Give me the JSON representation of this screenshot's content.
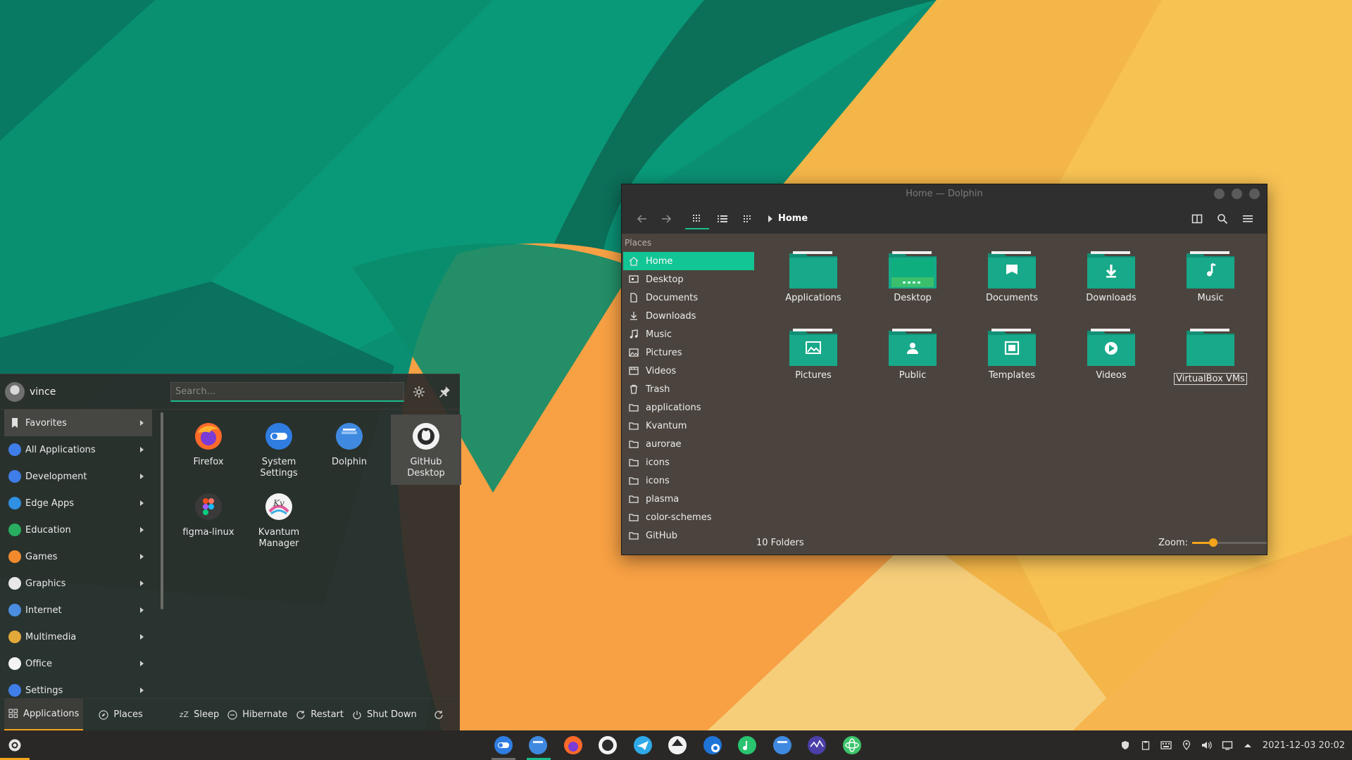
{
  "colors": {
    "accent": "#1abc8c",
    "highlight": "#f2a41a",
    "folder": "#17a98a"
  },
  "dolphin": {
    "title": "Home — Dolphin",
    "breadcrumb": "Home",
    "places_header": "Places",
    "places": [
      {
        "label": "Home",
        "icon": "home-icon"
      },
      {
        "label": "Desktop",
        "icon": "desktop-icon"
      },
      {
        "label": "Documents",
        "icon": "document-icon"
      },
      {
        "label": "Downloads",
        "icon": "download-icon"
      },
      {
        "label": "Music",
        "icon": "music-icon"
      },
      {
        "label": "Pictures",
        "icon": "picture-icon"
      },
      {
        "label": "Videos",
        "icon": "video-icon"
      },
      {
        "label": "Trash",
        "icon": "trash-icon"
      },
      {
        "label": "applications",
        "icon": "folder-icon"
      },
      {
        "label": "Kvantum",
        "icon": "folder-icon"
      },
      {
        "label": "aurorae",
        "icon": "folder-icon"
      },
      {
        "label": "icons",
        "icon": "folder-icon"
      },
      {
        "label": "icons",
        "icon": "folder-icon"
      },
      {
        "label": "plasma",
        "icon": "folder-icon"
      },
      {
        "label": "color-schemes",
        "icon": "folder-icon"
      },
      {
        "label": "GitHub",
        "icon": "folder-icon"
      }
    ],
    "folders": [
      {
        "label": "Applications",
        "emblem": "none"
      },
      {
        "label": "Desktop",
        "emblem": "desktop"
      },
      {
        "label": "Documents",
        "emblem": "document"
      },
      {
        "label": "Downloads",
        "emblem": "download"
      },
      {
        "label": "Music",
        "emblem": "music"
      },
      {
        "label": "Pictures",
        "emblem": "picture"
      },
      {
        "label": "Public",
        "emblem": "person"
      },
      {
        "label": "Templates",
        "emblem": "template"
      },
      {
        "label": "Videos",
        "emblem": "play"
      },
      {
        "label": "VirtualBox VMs",
        "emblem": "none"
      }
    ],
    "status": "10 Folders",
    "zoom_label": "Zoom:",
    "zoom_level": 0.28
  },
  "launcher": {
    "user": "vince",
    "search_placeholder": "Search...",
    "categories": [
      {
        "label": "Favorites",
        "color": "#d8d8d8"
      },
      {
        "label": "All Applications",
        "color": "#3f7ee8"
      },
      {
        "label": "Development",
        "color": "#3f7ee8"
      },
      {
        "label": "Edge Apps",
        "color": "#2f8fe0"
      },
      {
        "label": "Education",
        "color": "#27ae60"
      },
      {
        "label": "Games",
        "color": "#f08a2c"
      },
      {
        "label": "Graphics",
        "color": "#e8e8e8"
      },
      {
        "label": "Internet",
        "color": "#4b8de0"
      },
      {
        "label": "Multimedia",
        "color": "#e3a83a"
      },
      {
        "label": "Office",
        "color": "#f4f4f4"
      },
      {
        "label": "Settings",
        "color": "#3f7ee8"
      }
    ],
    "apps": [
      {
        "label": "Firefox",
        "icon": "firefox-icon"
      },
      {
        "label": "System Settings",
        "icon": "system-settings-icon"
      },
      {
        "label": "Dolphin",
        "icon": "dolphin-icon"
      },
      {
        "label": "GitHub Desktop",
        "icon": "github-icon"
      },
      {
        "label": "figma-linux",
        "icon": "figma-icon"
      },
      {
        "label": "Kvantum Manager",
        "icon": "kvantum-icon"
      }
    ],
    "bottom": {
      "applications": "Applications",
      "places": "Places",
      "sleep": "Sleep",
      "hibernate": "Hibernate",
      "restart": "Restart",
      "shutdown": "Shut Down"
    }
  },
  "taskbar": {
    "tasks": [
      "system-settings-icon",
      "dolphin-icon",
      "firefox-icon",
      "github-icon",
      "mail-icon",
      "inkscape-icon",
      "edge-icon",
      "music-icon",
      "dolphin-icon",
      "monitor-icon",
      "atom-icon"
    ],
    "clock": "2021-12-03 20:02"
  }
}
